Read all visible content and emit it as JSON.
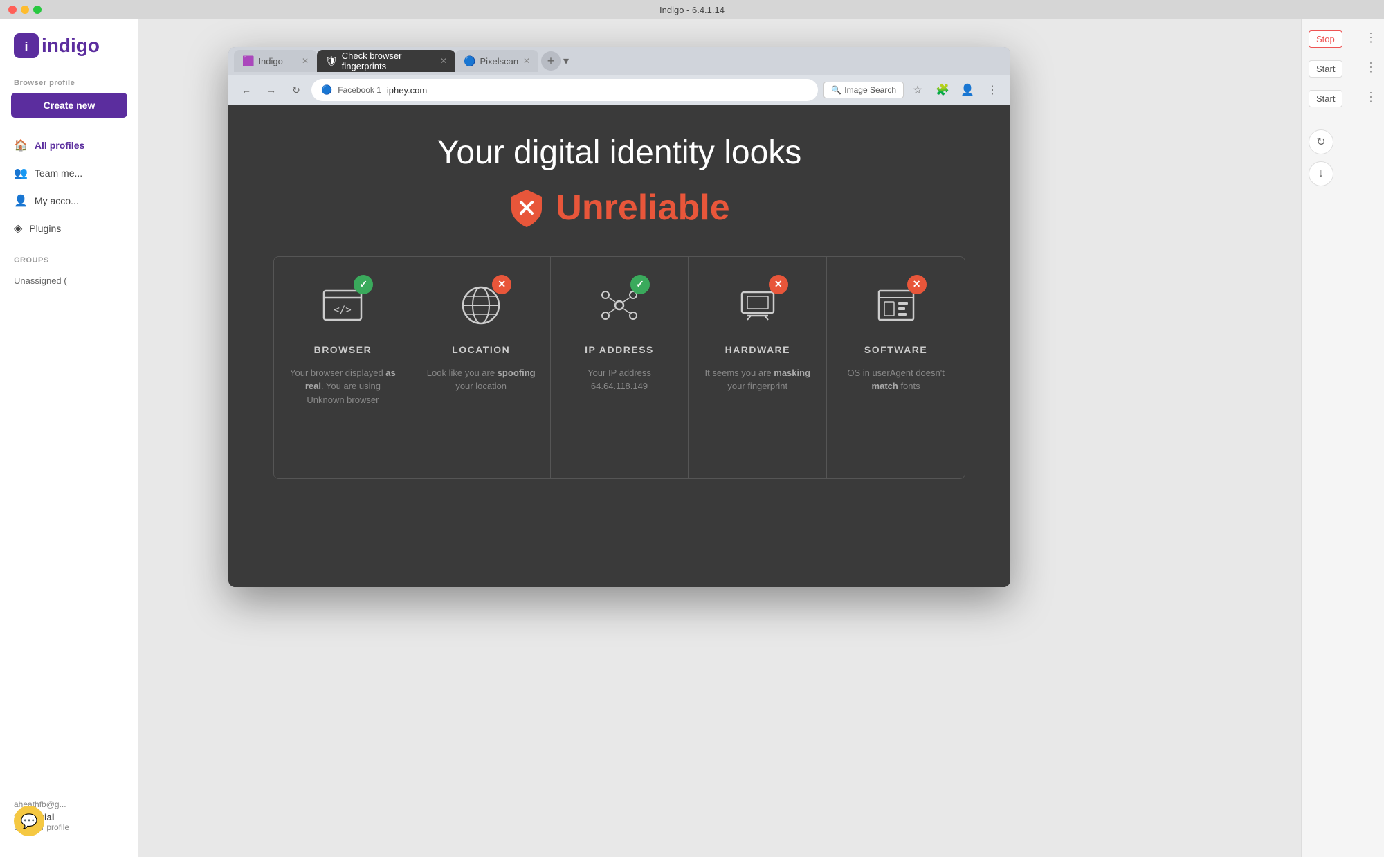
{
  "window": {
    "title": "Indigo - 6.4.1.14"
  },
  "traffic_lights": {
    "red": "red",
    "yellow": "yellow",
    "green": "green"
  },
  "sidebar": {
    "logo": "indigo",
    "browser_profile_label": "Browser profile",
    "create_new_label": "Create new",
    "nav_items": [
      {
        "id": "all-profiles",
        "label": "All profiles",
        "icon": "🏠",
        "active": true
      },
      {
        "id": "team-members",
        "label": "Team me...",
        "icon": "👥",
        "active": false
      },
      {
        "id": "my-account",
        "label": "My acco...",
        "icon": "👤",
        "active": false
      },
      {
        "id": "plugins",
        "label": "Plugins",
        "icon": "◈",
        "active": false
      }
    ],
    "groups_label": "GROUPS",
    "groups": [
      {
        "id": "unassigned",
        "label": "Unassigned ("
      }
    ],
    "user_email": "aheathfb@g...",
    "plan_name": "Solo Trial",
    "plan_sub": "Browser profile"
  },
  "browser": {
    "tabs": [
      {
        "id": "indigo",
        "label": "Indigo",
        "favicon": "🟪",
        "active": false
      },
      {
        "id": "check-fingerprints",
        "label": "Check browser fingerprints",
        "favicon": "🛡",
        "active": true
      },
      {
        "id": "pixelscan",
        "label": "Pixelscan",
        "favicon": "🔵",
        "active": false
      }
    ],
    "address_bar": {
      "profile_label": "Facebook 1",
      "url": "iphey.com",
      "search_button": "Image Search"
    },
    "content": {
      "headline": "Your digital identity looks",
      "status": "Unreliable",
      "shield_icon": "shield-x",
      "cards": [
        {
          "id": "browser",
          "title": "BROWSER",
          "status": "pass",
          "icon": "browser",
          "description": "Your browser displayed as real. You are using Unknown browser",
          "bold_word": "as real"
        },
        {
          "id": "location",
          "title": "LOCATION",
          "status": "fail",
          "icon": "globe",
          "description": "Look like you are spoofing your location",
          "bold_word": "spoofing"
        },
        {
          "id": "ip-address",
          "title": "IP ADDRESS",
          "status": "pass",
          "icon": "network",
          "description": "Your IP address 64.64.118.149",
          "bold_word": ""
        },
        {
          "id": "hardware",
          "title": "HARDWARE",
          "status": "fail",
          "icon": "laptop",
          "description": "It seems you are masking your fingerprint",
          "bold_word": "masking"
        },
        {
          "id": "software",
          "title": "SOFTWARE",
          "status": "fail",
          "icon": "code",
          "description": "OS in userAgent doesn't match fonts",
          "bold_word": "match"
        }
      ]
    }
  },
  "right_panel": {
    "actions": [
      {
        "id": "stop-1",
        "label": "Stop",
        "type": "stop"
      },
      {
        "id": "start-2",
        "label": "Start",
        "type": "start"
      },
      {
        "id": "start-3",
        "label": "Start",
        "type": "start"
      }
    ]
  },
  "chat_button": "💬"
}
